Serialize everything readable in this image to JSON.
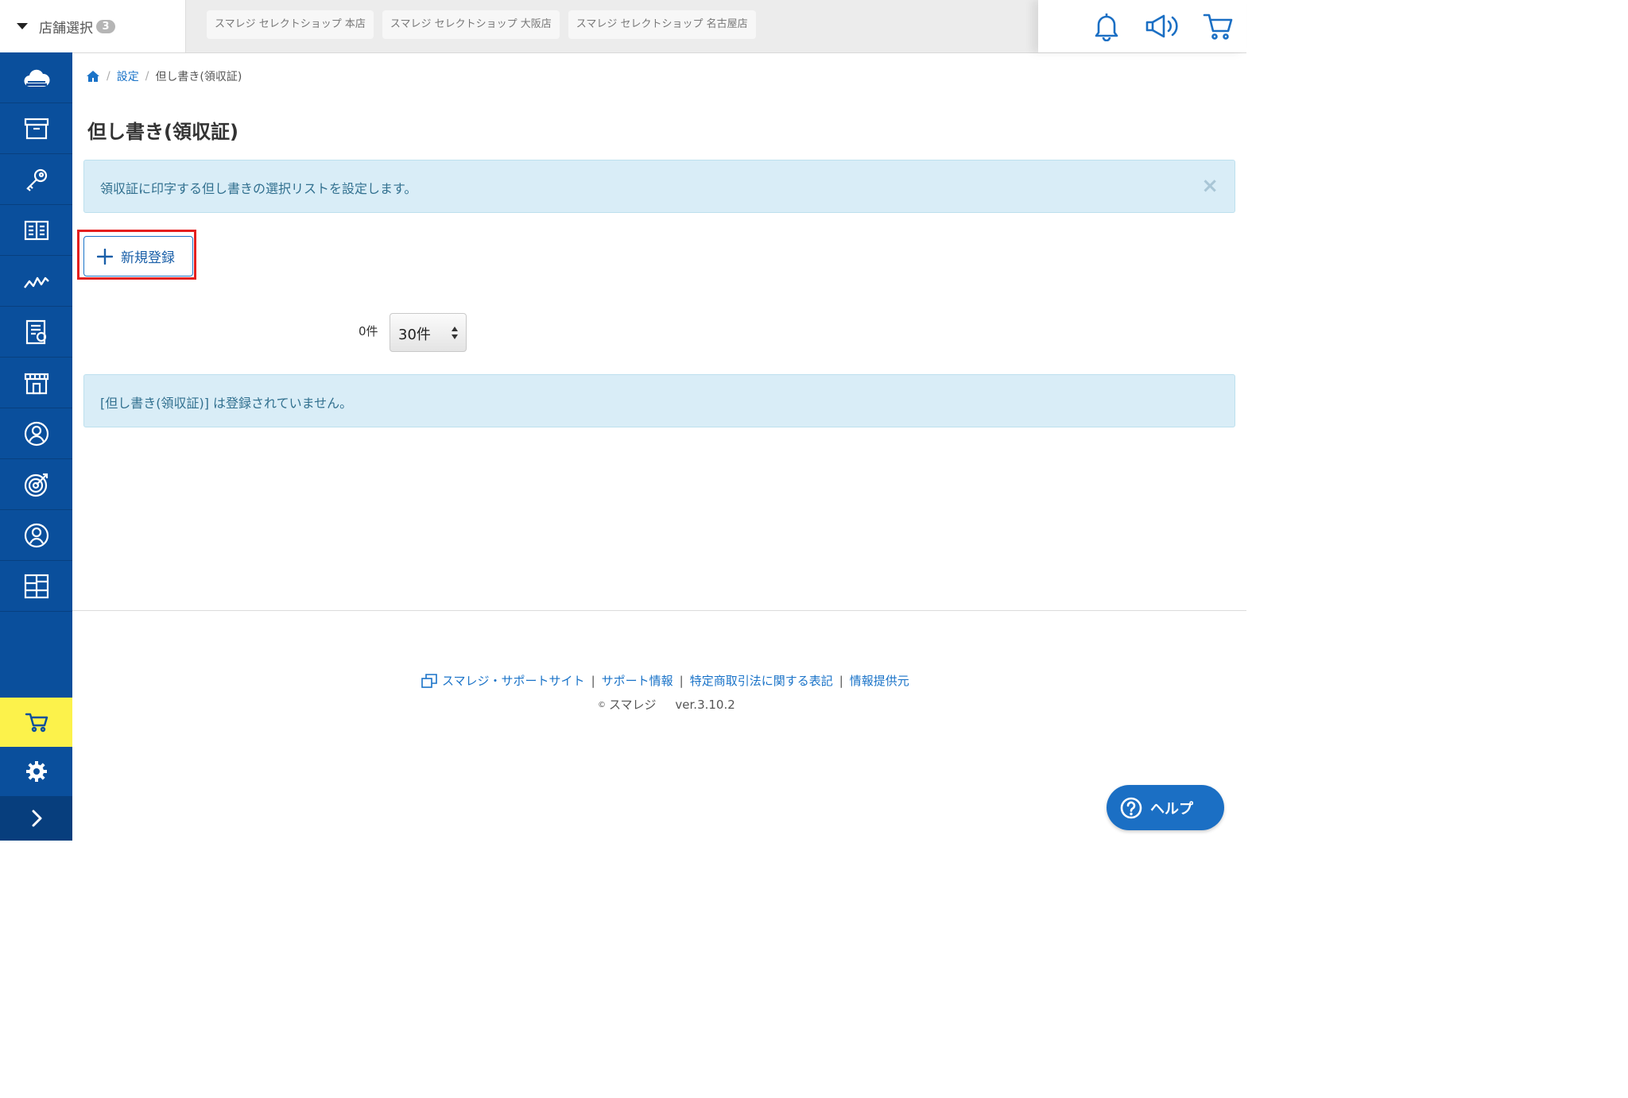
{
  "header": {
    "store_select_label": "店舗選択",
    "store_count": "3",
    "store_tabs": [
      "スマレジ セレクトショップ 本店",
      "スマレジ セレクトショップ 大阪店",
      "スマレジ セレクトショップ 名古屋店"
    ],
    "icons": [
      "bell-icon",
      "megaphone-icon",
      "cart-icon"
    ]
  },
  "sidebar": {
    "items": [
      "cloud-icon",
      "archive-box-icon",
      "key-icon",
      "book-icon",
      "trend-chart-icon",
      "report-icon",
      "store-icon",
      "user-circle-icon",
      "target-icon",
      "person-icon",
      "grid-layout-icon"
    ],
    "bottom": [
      "cart-icon",
      "gear-icon",
      "chevron-right-icon"
    ],
    "active_color": "#fcf24b",
    "bg_color": "#0a4f9c"
  },
  "breadcrumb": {
    "home_icon": "home-icon",
    "items": [
      "設定",
      "但し書き(領収証)"
    ]
  },
  "page": {
    "title": "但し書き(領収証)",
    "info_text": "領収証に印字する但し書きの選択リストを設定します。",
    "close_symbol": "×",
    "new_button_label": "新規登録",
    "count_label": "0件",
    "per_page_value": "30件",
    "empty_message": "[但し書き(領収証)] は登録されていません。"
  },
  "footer": {
    "links": [
      "スマレジ・サポートサイト",
      "サポート情報",
      "特定商取引法に関する表記",
      "情報提供元"
    ],
    "copyright_symbol": "©",
    "copyright_name": "スマレジ",
    "version": "ver.3.10.2"
  },
  "help": {
    "label": "ヘルプ"
  }
}
